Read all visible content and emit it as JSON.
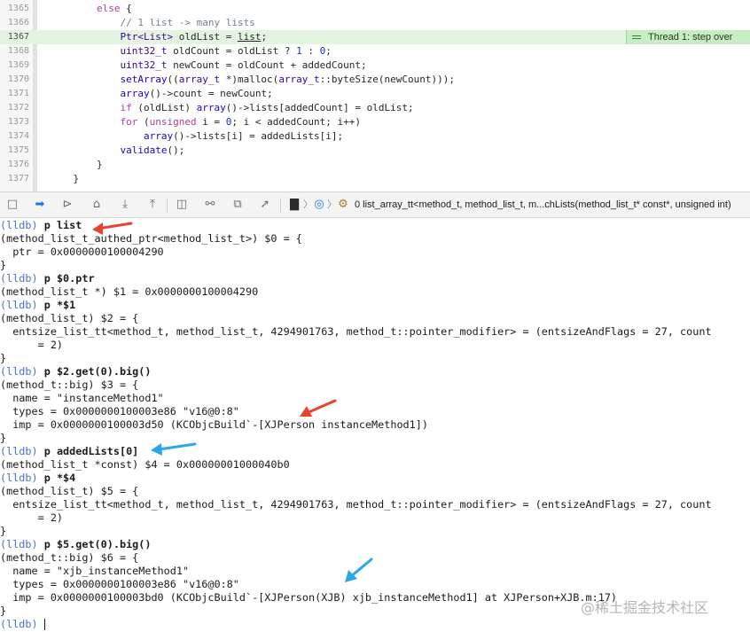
{
  "editor": {
    "lines": [
      {
        "num": "1365",
        "tokens": [
          {
            "t": "        "
          },
          {
            "t": "else",
            "c": "kw"
          },
          {
            "t": " {"
          }
        ]
      },
      {
        "num": "1366",
        "tokens": [
          {
            "t": "            "
          },
          {
            "t": "// 1 list -> many lists",
            "c": "cm"
          }
        ]
      },
      {
        "num": "1367",
        "current": true,
        "tokens": [
          {
            "t": "            "
          },
          {
            "t": "Ptr<List>",
            "c": "ty"
          },
          {
            "t": " oldList = "
          },
          {
            "t": "list",
            "c": "ul"
          },
          {
            "t": ";"
          }
        ]
      },
      {
        "num": "1368",
        "tokens": [
          {
            "t": "            "
          },
          {
            "t": "uint32_t",
            "c": "ty"
          },
          {
            "t": " oldCount = oldList ? "
          },
          {
            "t": "1",
            "c": "num"
          },
          {
            "t": " : "
          },
          {
            "t": "0",
            "c": "num"
          },
          {
            "t": ";"
          }
        ]
      },
      {
        "num": "1369",
        "tokens": [
          {
            "t": "            "
          },
          {
            "t": "uint32_t",
            "c": "ty"
          },
          {
            "t": " newCount = oldCount + addedCount;"
          }
        ]
      },
      {
        "num": "1370",
        "tokens": [
          {
            "t": "            "
          },
          {
            "t": "setArray",
            "c": "fn"
          },
          {
            "t": "(("
          },
          {
            "t": "array_t",
            "c": "ty"
          },
          {
            "t": " *)malloc("
          },
          {
            "t": "array_t",
            "c": "ty"
          },
          {
            "t": "::byteSize(newCount)));"
          }
        ]
      },
      {
        "num": "1371",
        "tokens": [
          {
            "t": "            "
          },
          {
            "t": "array",
            "c": "fn"
          },
          {
            "t": "()->count = newCount;"
          }
        ]
      },
      {
        "num": "1372",
        "tokens": [
          {
            "t": "            "
          },
          {
            "t": "if",
            "c": "kw"
          },
          {
            "t": " (oldList) "
          },
          {
            "t": "array",
            "c": "fn"
          },
          {
            "t": "()->lists[addedCount] = oldList;"
          }
        ]
      },
      {
        "num": "1373",
        "tokens": [
          {
            "t": "            "
          },
          {
            "t": "for",
            "c": "kw"
          },
          {
            "t": " ("
          },
          {
            "t": "unsigned",
            "c": "kw"
          },
          {
            "t": " i = "
          },
          {
            "t": "0",
            "c": "num"
          },
          {
            "t": "; i < addedCount; i++)"
          }
        ]
      },
      {
        "num": "1374",
        "tokens": [
          {
            "t": "                "
          },
          {
            "t": "array",
            "c": "fn"
          },
          {
            "t": "()->lists[i] = addedLists[i];"
          }
        ]
      },
      {
        "num": "1375",
        "tokens": [
          {
            "t": "            "
          },
          {
            "t": "validate",
            "c": "fn"
          },
          {
            "t": "();"
          }
        ]
      },
      {
        "num": "1376",
        "tokens": [
          {
            "t": "        }"
          }
        ]
      },
      {
        "num": "1377",
        "tokens": [
          {
            "t": "    }"
          }
        ]
      }
    ],
    "thread_badge": "Thread 1: step over"
  },
  "debug_bar": {
    "icons": [
      "hide-debug-area-icon",
      "breakpoints-toggle-icon",
      "continue-icon",
      "step-over-icon",
      "step-into-icon",
      "step-out-icon",
      "debug-view-hierarchy-icon",
      "memory-graph-icon",
      "environment-overrides-icon",
      "simulate-location-icon",
      "thread-icon",
      "queue-icon",
      "stack-frame-icon"
    ],
    "frame": "0 list_array_tt<method_t, method_list_t, m...chLists(method_list_t* const*, unsigned int)"
  },
  "console": {
    "prompt": "(lldb)",
    "lines": [
      {
        "prompt": true,
        "cmd": "p list"
      },
      {
        "text": "(method_list_t_authed_ptr<method_list_t>) $0 = {"
      },
      {
        "text": "  ptr = 0x0000000100004290"
      },
      {
        "text": "}"
      },
      {
        "prompt": true,
        "cmd": "p $0.ptr"
      },
      {
        "text": "(method_list_t *) $1 = 0x0000000100004290"
      },
      {
        "prompt": true,
        "cmd": "p *$1"
      },
      {
        "text": "(method_list_t) $2 = {"
      },
      {
        "text": "  entsize_list_tt<method_t, method_list_t, 4294901763, method_t::pointer_modifier> = (entsizeAndFlags = 27, count"
      },
      {
        "text": "      = 2)"
      },
      {
        "text": "}"
      },
      {
        "prompt": true,
        "cmd": "p $2.get(0).big()"
      },
      {
        "text": "(method_t::big) $3 = {"
      },
      {
        "text": "  name = \"instanceMethod1\""
      },
      {
        "text": "  types = 0x0000000100003e86 \"v16@0:8\""
      },
      {
        "text": "  imp = 0x0000000100003d50 (KCObjcBuild`-[XJPerson instanceMethod1])"
      },
      {
        "text": "}"
      },
      {
        "prompt": true,
        "cmd": "p addedLists[0]"
      },
      {
        "text": "(method_list_t *const) $4 = 0x00000001000040b0"
      },
      {
        "prompt": true,
        "cmd": "p *$4"
      },
      {
        "text": "(method_list_t) $5 = {"
      },
      {
        "text": "  entsize_list_tt<method_t, method_list_t, 4294901763, method_t::pointer_modifier> = (entsizeAndFlags = 27, count"
      },
      {
        "text": "      = 2)"
      },
      {
        "text": "}"
      },
      {
        "prompt": true,
        "cmd": "p $5.get(0).big()"
      },
      {
        "text": "(method_t::big) $6 = {"
      },
      {
        "text": "  name = \"xjb_instanceMethod1\""
      },
      {
        "text": "  types = 0x0000000100003e86 \"v16@0:8\""
      },
      {
        "text": "  imp = 0x0000000100003bd0 (KCObjcBuild`-[XJPerson(XJB) xjb_instanceMethod1] at XJPerson+XJB.m:17)"
      },
      {
        "text": "}"
      },
      {
        "prompt": true,
        "cmd": ""
      }
    ]
  },
  "annotations": {
    "red": "#e8432e",
    "blue": "#2aa7e8"
  },
  "watermark": "@稀土掘金技术社区"
}
